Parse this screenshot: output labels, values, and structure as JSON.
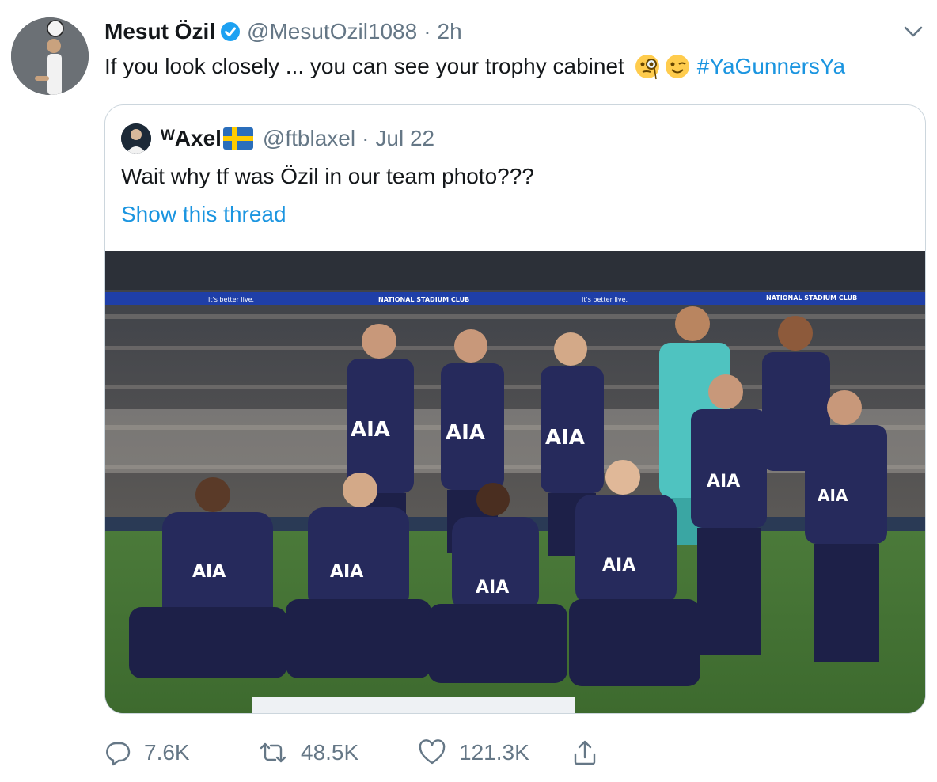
{
  "tweet": {
    "author": {
      "display_name": "Mesut Özil",
      "handle": "@MesutOzil1088",
      "verified": true,
      "separator": "·",
      "time": "2h"
    },
    "text": "If you look closely ... you can see your trophy cabinet",
    "emojis": [
      "monocle-face-emoji",
      "winking-face-emoji"
    ],
    "hashtag": "#YaGunnersYa",
    "quoted": {
      "display_name": "ᵂAxel",
      "flag": "sweden-flag-icon",
      "handle": "@ftblaxel",
      "separator": "·",
      "time": "Jul 22",
      "text": "Wait why tf was Özil in our team photo???",
      "show_thread": "Show this thread",
      "photo": {
        "banner_texts": [
          "It's better live.",
          "NATIONAL STADIUM CLUB",
          "It's better live.",
          "NATIONAL STADIUM CLUB"
        ],
        "shirt_sponsor": "AIA"
      }
    },
    "actions": {
      "reply_count": "7.6K",
      "retweet_count": "48.5K",
      "like_count": "121.3K"
    }
  },
  "colors": {
    "link": "#1b95e0",
    "secondary_text": "#657786",
    "border": "#ccd6dd",
    "verified": "#1da1f2",
    "kit_navy": "#262a5c",
    "keeper_teal": "#4fc3c0"
  }
}
